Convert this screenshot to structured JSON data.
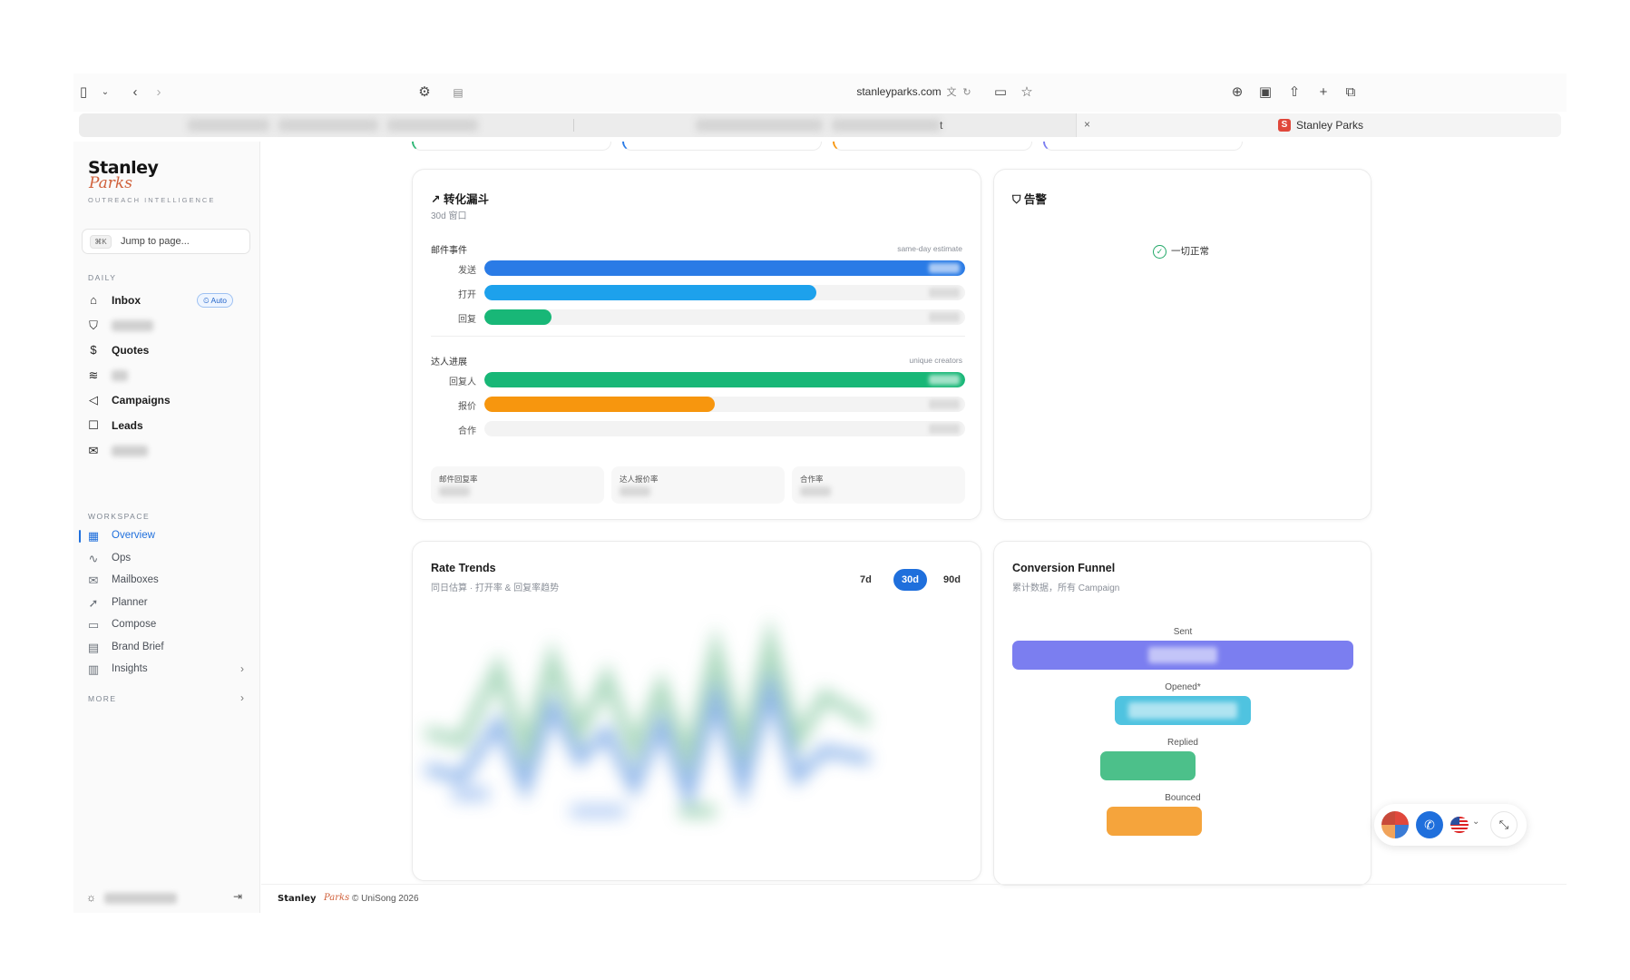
{
  "browser": {
    "url": "stanleyparks.com",
    "active_tab": "Stanley Parks",
    "tab_fragment": "t",
    "tab_close": "×"
  },
  "brand": {
    "name_line1": "Stanley",
    "name_line2": "Parks",
    "tagline": "OUTREACH INTELLIGENCE",
    "accent": "#d0603a"
  },
  "sidebar": {
    "jump": {
      "kbd": "⌘K",
      "placeholder": "Jump to page..."
    },
    "daily_label": "DAILY",
    "daily": [
      {
        "label": "Inbox",
        "icon": "inbox-icon",
        "badge": "Auto"
      },
      {
        "label": "",
        "icon": "shield-icon"
      },
      {
        "label": "Quotes",
        "icon": "quote-icon"
      },
      {
        "label": "",
        "icon": "layers-icon"
      },
      {
        "label": "Campaigns",
        "icon": "megaphone-icon"
      },
      {
        "label": "Leads",
        "icon": "contact-icon"
      },
      {
        "label": "",
        "icon": "mail-icon"
      }
    ],
    "workspace_label": "WORKSPACE",
    "workspace": [
      {
        "label": "Overview",
        "icon": "grid-icon",
        "active": true
      },
      {
        "label": "Ops",
        "icon": "activity-icon"
      },
      {
        "label": "Mailboxes",
        "icon": "mailbox-icon"
      },
      {
        "label": "Planner",
        "icon": "rocket-icon"
      },
      {
        "label": "Compose",
        "icon": "compose-icon"
      },
      {
        "label": "Brand Brief",
        "icon": "document-icon"
      },
      {
        "label": "Insights",
        "icon": "bar-chart-icon"
      }
    ],
    "more_label": "MORE"
  },
  "funnel_cn": {
    "title": "转化漏斗",
    "subtitle": "30d 窗口",
    "group1": {
      "label": "邮件事件",
      "note": "same-day estimate",
      "rows": [
        {
          "label": "发送",
          "fill": 1.0,
          "color": "#2a7be6"
        },
        {
          "label": "打开",
          "fill": 0.69,
          "color": "#1da1ec"
        },
        {
          "label": "回复",
          "fill": 0.14,
          "color": "#18b777"
        }
      ]
    },
    "group2": {
      "label": "达人进展",
      "note": "unique creators",
      "rows": [
        {
          "label": "回复人",
          "fill": 1.0,
          "color": "#18b777"
        },
        {
          "label": "报价",
          "fill": 0.48,
          "color": "#f7960e"
        },
        {
          "label": "合作",
          "fill": 0.0,
          "color": "#18b777"
        }
      ]
    },
    "stats": [
      {
        "label": "邮件回复率"
      },
      {
        "label": "达人报价率"
      },
      {
        "label": "合作率"
      }
    ]
  },
  "alerts": {
    "title": "告警",
    "status": "一切正常",
    "status_color": "#22a868"
  },
  "rate_trends": {
    "title": "Rate Trends",
    "subtitle": "同日估算 · 打开率 & 回复率趋势",
    "ranges": [
      "7d",
      "30d",
      "90d"
    ],
    "selected_range": "30d"
  },
  "conversion_funnel": {
    "title": "Conversion Funnel",
    "subtitle": "累计数据，所有 Campaign",
    "stages": [
      {
        "label": "Sent",
        "relative": 1.0,
        "color": "#7b7ef0"
      },
      {
        "label": "Opened*",
        "relative": 0.4,
        "color": "#4fc3e0"
      },
      {
        "label": "Replied",
        "relative": 0.28,
        "color": "#4cc08a"
      },
      {
        "label": "Bounced",
        "relative": 0.28,
        "color": "#f5a43c"
      }
    ]
  },
  "footer": {
    "logo1": "Stanley",
    "logo2": "Parks",
    "copyright": "© UniSong 2026"
  }
}
